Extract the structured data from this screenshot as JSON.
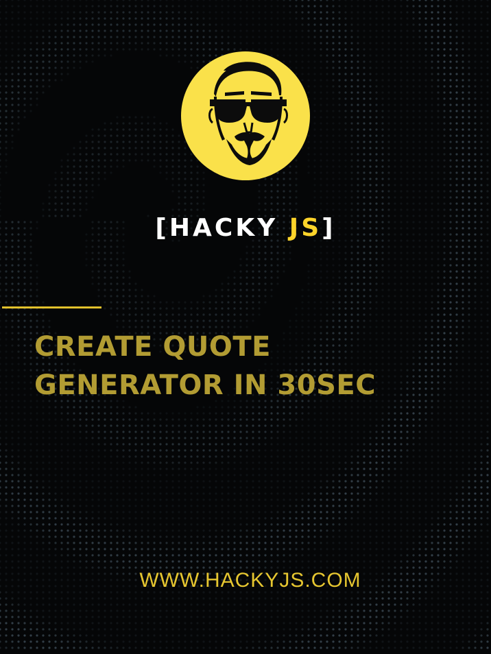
{
  "brand": {
    "open_bracket": "[",
    "name_part1": "HACKY",
    "name_part2": "JS",
    "close_bracket": "]"
  },
  "headline": {
    "line1": "CREATE QUOTE",
    "line2": "GENERATOR IN 30SEC"
  },
  "footer": {
    "website": "WWW.HACKYJS.COM"
  },
  "colors": {
    "background": "#050607",
    "logo_circle": "#fae14a",
    "brand_accent": "#ffd42a",
    "headline": "#b29c33",
    "website": "#e6c630"
  },
  "icons": {
    "logo": "bearded-man-sunglasses-icon",
    "background": "dot-wave-pattern"
  }
}
